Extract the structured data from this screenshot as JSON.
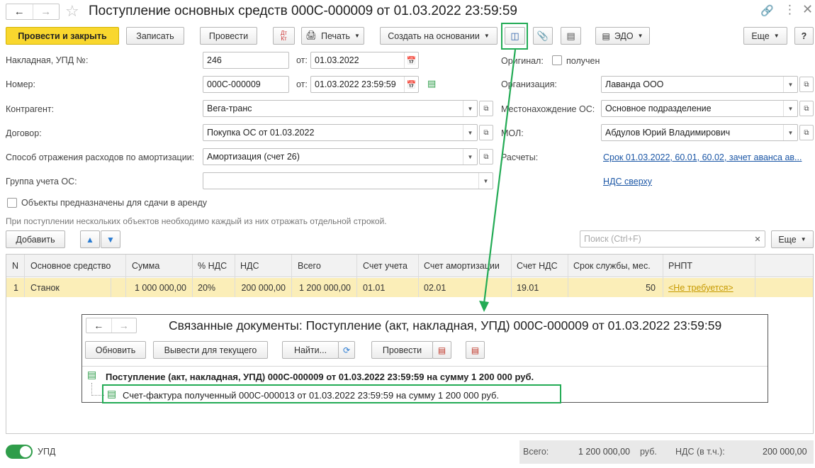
{
  "header": {
    "title": "Поступление основных средств 000С-000009 от 01.03.2022 23:59:59"
  },
  "toolbar": {
    "post_close": "Провести и закрыть",
    "save": "Записать",
    "post": "Провести",
    "dtkt_top": "Дт",
    "dtkt_bottom": "Кт",
    "print": "Печать",
    "create_based": "Создать на основании",
    "edo": "ЭДО",
    "more": "Еще",
    "help": "?"
  },
  "form": {
    "invoice_label": "Накладная, УПД №:",
    "invoice_no": "246",
    "from_label": "от:",
    "invoice_date": "01.03.2022",
    "number_label": "Номер:",
    "number": "000С-000009",
    "number_date": "01.03.2022 23:59:59",
    "counterparty_label": "Контрагент:",
    "counterparty": "Вега-транс",
    "contract_label": "Договор:",
    "contract": "Покупка ОС от 01.03.2022",
    "depreciation_label": "Способ отражения расходов по амортизации:",
    "depreciation": "Амортизация (счет 26)",
    "group_label": "Группа учета ОС:",
    "group": "",
    "lease_label": "Объекты предназначены для сдачи в аренду",
    "original_label": "Оригинал:",
    "received_label": "получен",
    "org_label": "Организация:",
    "org": "Лаванда ООО",
    "location_label": "Местонахождение ОС:",
    "location": "Основное подразделение",
    "mol_label": "МОЛ:",
    "mol": "Абдулов Юрий Владимирович",
    "settlements_label": "Расчеты:",
    "settlements_link": "Срок 01.03.2022, 60.01, 60.02, зачет аванса ав...",
    "vat_link": "НДС сверху",
    "hint": "При поступлении нескольких объектов необходимо каждый из них отражать отдельной строкой."
  },
  "table_toolbar": {
    "add": "Добавить",
    "search_placeholder": "Поиск (Ctrl+F)",
    "more": "Еще"
  },
  "table": {
    "columns": [
      "N",
      "Основное средство",
      "Сумма",
      "% НДС",
      "НДС",
      "Всего",
      "Счет учета",
      "Счет амортизации",
      "Счет НДС",
      "Срок службы, мес.",
      "РНПТ"
    ],
    "rows": [
      [
        "1",
        "Станок",
        "1 000 000,00",
        "20%",
        "200 000,00",
        "1 200 000,00",
        "01.01",
        "02.01",
        "19.01",
        "50",
        "<Не требуется>"
      ]
    ]
  },
  "popup": {
    "title": "Связанные документы: Поступление (акт, накладная, УПД) 000С-000009 от 01.03.2022 23:59:59",
    "refresh": "Обновить",
    "show_current": "Вывести для текущего",
    "find": "Найти...",
    "post": "Провести",
    "doc1": "Поступление (акт, накладная, УПД) 000С-000009 от 01.03.2022 23:59:59 на сумму 1 200 000 руб.",
    "doc2": "Счет-фактура полученный 000С-000013 от 01.03.2022 23:59:59 на сумму 1 200 000 руб."
  },
  "footer": {
    "upd_label": "УПД",
    "total_label": "Всего:",
    "total": "1 200 000,00",
    "currency": "руб.",
    "vat_label": "НДС (в т.ч.):",
    "vat": "200 000,00"
  },
  "colors": {
    "primary_button": "#f9d72e",
    "highlight": "#23ab55",
    "selected_row": "#fbeeb8",
    "link": "#1c57a6"
  }
}
